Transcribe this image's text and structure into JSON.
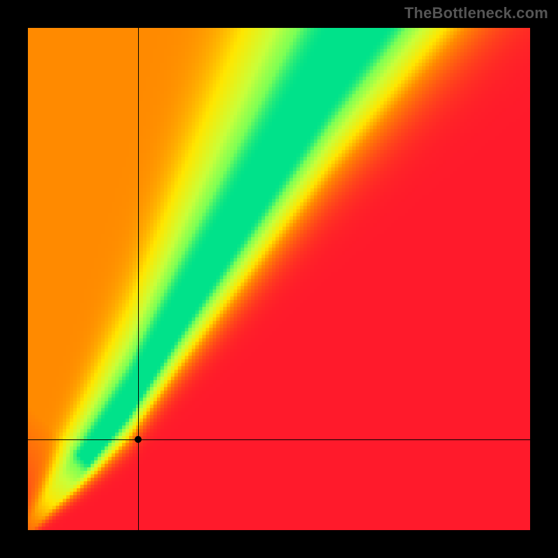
{
  "watermark": "TheBottleneck.com",
  "chart_data": {
    "type": "heatmap",
    "title": "",
    "xlabel": "",
    "ylabel": "",
    "xlim": [
      0,
      100
    ],
    "ylim": [
      0,
      100
    ],
    "grid": false,
    "legend": "none",
    "colormap": {
      "description": "red → orange → yellow → green diverging; green band marks balanced pairing",
      "stops": [
        {
          "value": 0.0,
          "color": "#ff1a2b"
        },
        {
          "value": 0.35,
          "color": "#ff8a00"
        },
        {
          "value": 0.55,
          "color": "#ffe600"
        },
        {
          "value": 0.78,
          "color": "#c8ff3a"
        },
        {
          "value": 0.92,
          "color": "#7dff55"
        },
        {
          "value": 1.0,
          "color": "#00e28a"
        }
      ]
    },
    "optimal_curve": {
      "description": "Green ridge: GPU score needed to avoid bottleneck for given CPU score (steep, slightly super-linear; approximate points read off chart)",
      "points": [
        {
          "x": 0,
          "y": 0
        },
        {
          "x": 10,
          "y": 12
        },
        {
          "x": 20,
          "y": 25
        },
        {
          "x": 30,
          "y": 42
        },
        {
          "x": 40,
          "y": 58
        },
        {
          "x": 50,
          "y": 74
        },
        {
          "x": 60,
          "y": 90
        },
        {
          "x": 67,
          "y": 100
        }
      ],
      "band_halfwidth_x": 3
    },
    "marker": {
      "description": "Black crosshair/dot marking the selected hardware pairing",
      "x": 22,
      "y": 18
    }
  }
}
